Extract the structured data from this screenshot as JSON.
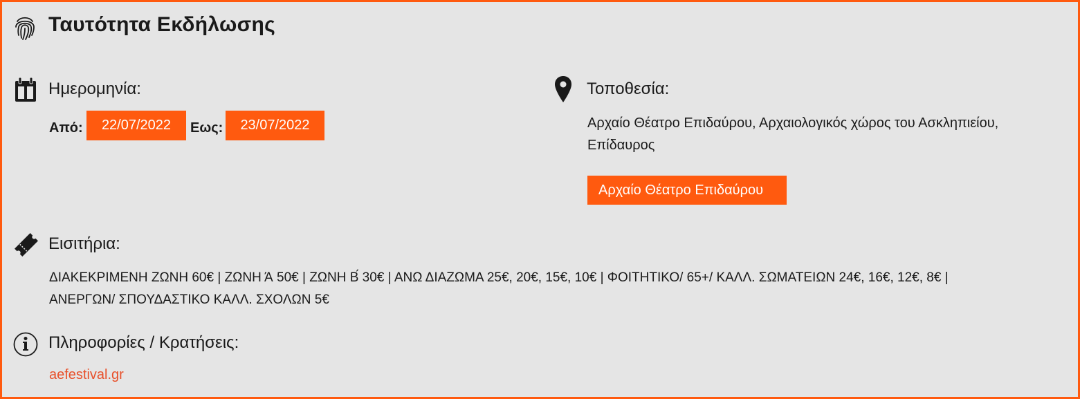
{
  "title": "Ταυτότητα Εκδήλωσης",
  "date": {
    "heading": "Ημερομηνία:",
    "from_label": "Από:",
    "from_value": "22/07/2022",
    "to_label": "Εως:",
    "to_value": "23/07/2022"
  },
  "location": {
    "heading": "Τοποθεσία:",
    "address_line1": "Αρχαίο Θέατρο Επιδαύρου, Αρχαιολογικός χώρος του Ασκληπιείου,",
    "address_line2": "Επίδαυρος",
    "button_label": "Αρχαίο Θέατρο Επιδαύρου"
  },
  "tickets": {
    "heading": "Εισιτήρια:",
    "line1": "ΔΙΑΚΕΚΡΙΜΕΝΗ ΖΩΝΗ 60€ | ΖΩΝΗ Ά 50€ | ΖΩΝΗ Β́ 30€ | ΑΝΩ ΔΙΑΖΩΜΑ 25€, 20€, 15€, 10€ | ΦΟΙΤΗΤΙΚΟ/ 65+/ ΚΑΛΛ. ΣΩΜΑΤΕΙΩΝ 24€, 16€, 12€, 8€ |",
    "line2": "ΑΝΕΡΓΩΝ/ ΣΠΟΥΔΑΣΤΙΚΟ ΚΑΛΛ. ΣΧΟΛΩΝ 5€"
  },
  "info": {
    "heading": "Πληροφορίες / Κρατήσεις:",
    "link_text": "aefestival.gr"
  },
  "colors": {
    "accent": "#ff5a0f",
    "background": "#e5e5e5",
    "link": "#e8502a"
  },
  "icons": {
    "title": "fingerprint-icon",
    "date": "calendar-icon",
    "location": "map-pin-icon",
    "tickets": "ticket-icon",
    "info": "info-icon"
  }
}
